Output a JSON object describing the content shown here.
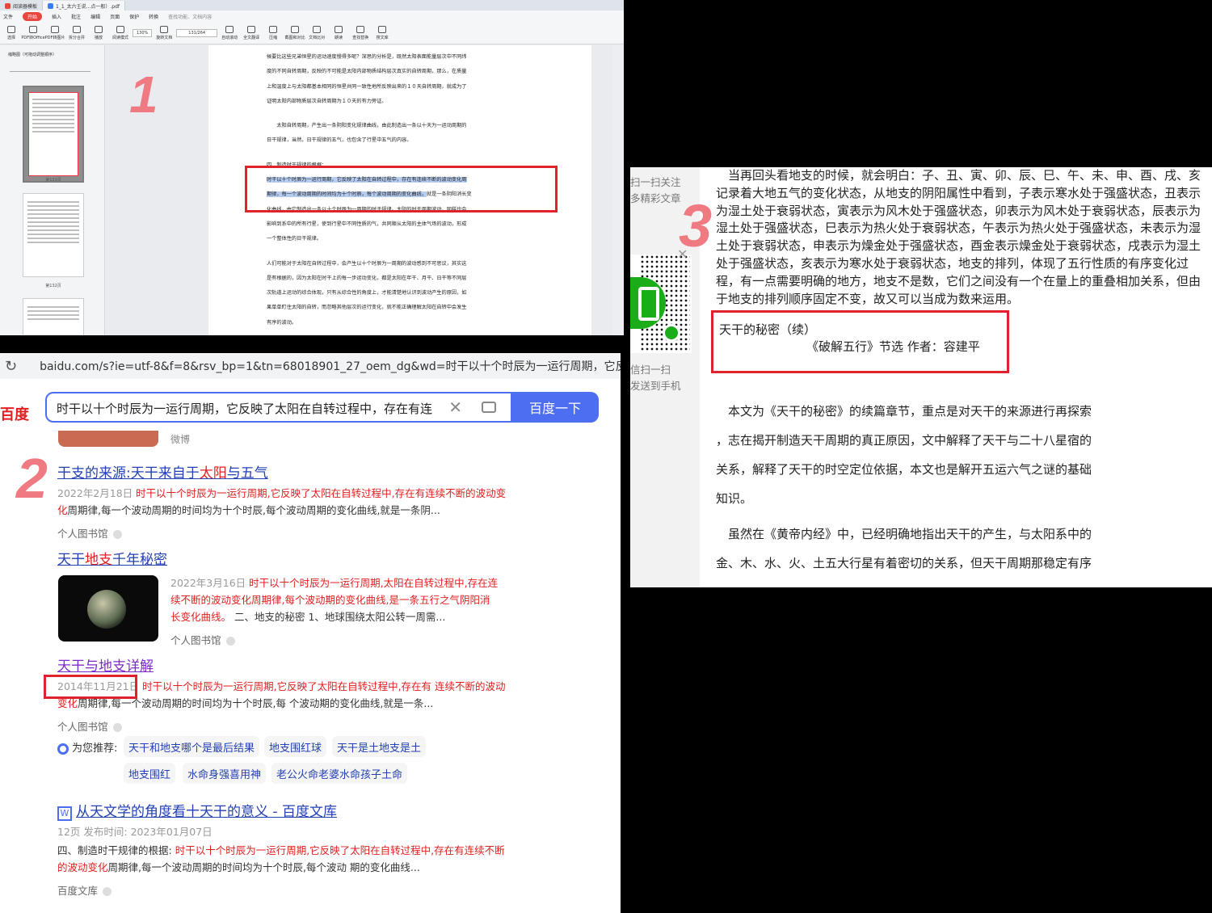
{
  "pdf": {
    "tabs": [
      "阅读器模板",
      "1_1_太六壬说...点一般）.pdf"
    ],
    "menu": [
      "文件",
      "开始",
      "插入",
      "批注",
      "编辑",
      "页面",
      "保护",
      "转换",
      "查找功能、文档内容"
    ],
    "tools": [
      "选择",
      "PDF转Office",
      "PDF转图片",
      "拆分合并",
      "播放",
      "阅读模式",
      "旋转文档",
      "单页",
      "双页",
      "连续阅读",
      "自动滚动",
      "全文翻译",
      "压缩",
      "截图和对比",
      "文档比对",
      "朗读",
      "查找替换",
      "搜文库"
    ],
    "zoom": "130%",
    "page": "131/264",
    "sidebar_title": "缩略图（可拖动调整顺序）",
    "thumb_labels": [
      "第131页",
      "第132页"
    ],
    "doc_lines": [
      "候要比这些兄弟恒星的运动速度慢得多呢？深思的分析是，既然太阳表面能量层次中不同纬",
      "度的不同自转周期，反映的不可能是太阳内部物质结构层次真实的自转周期，那么，在质量",
      "上和温度上与太阳都基本相同的恒星共同一致性地所反映出来的１０天自转周期，就成为了",
      "证明太阳内部物质层次自转周期为１０天的有力旁证。"
    ],
    "doc_para2": [
      "　　太阳自转周期，产生出一条阴阳变化规律曲线，由此制造出一条以十天为一运动周期的",
      "日干规律，当然，日干规律的五气，也包含了行星中五气的内容。"
    ],
    "doc_heading": "四、制造时干规律的根据：",
    "doc_hl1": "时干以十个时辰为一运行周期，它反映了太阳在自转过程中，存在有连续不断的波动变化周",
    "doc_hl2": "期律，每一个波动周期的时间均为十个时辰，每个波动周期的变化曲线，",
    "doc_hl2_rest": "就是一条阴阳消长变",
    "doc_lines3": [
      "化曲线，由它制造出一条以十个时辰为一周期的时干规律。太阳的时干周期波动，同样也会",
      "影响到系中的所有行星，使到行星中不同性质的气，共同顺从太阳的主体气场的波动，形成",
      "一个整体性的日干规律。"
    ],
    "doc_lines4": [
      "人们可能对于太阳在自转过程中，会产生以十个时辰为一周期的波动感到不可思议，其实这",
      "是有根据的，因为太阳在时干上的每一步运动变化，都是太阳在年干、月干、日干等不同层",
      "次轨道上运动的综合体现，只有从综合性的角度上，才能清楚地认识到波动产生的原因，如",
      "果单单盯住太阳的自转，而忽略其他层次的运行变化，就不能正确理解太阳在自转中会发生",
      "有序的波动。"
    ]
  },
  "baidu": {
    "url": "baidu.com/s?ie=utf-8&f=8&rsv_bp=1&tn=68018901_27_oem_dg&wd=时干以十个时辰为一运行周期，它反映",
    "logo": "百度",
    "query": "时干以十个时辰为一运行周期，它反映了太阳在自转过程中，存在有连",
    "search_btn": "百度一下",
    "top_source": "微博",
    "results": [
      {
        "title_a": "干支的来源:天干来自于",
        "title_em": "太阳",
        "title_b": "与五气",
        "date": "2022年2月18日",
        "snip_em": "时干以十个时辰为一运行周期,它反映了太阳在自转过程中,存在有连续不断的波动变化",
        "snip": "周期律,每一个波动周期的时间均为十个时辰,每个波动周期的变化曲线,就是一条阴...",
        "source": "个人图书馆"
      },
      {
        "title_a": "天干",
        "title_em": "地支",
        "title_b": "千年秘密",
        "date": "2022年3月16日",
        "snip_em": "时干以十个时辰为一运行周期,太阳在自转过程中,存在连续不断的波动变化周期律,每个波动期的变化曲线,是一条五行之气阴阳消长变化曲线。",
        "snip": " 二、地支的秘密 1、地球围绕太阳公转一周需...",
        "source": "个人图书馆"
      },
      {
        "title_a": "天干与地支详解",
        "title_em": "",
        "title_b": "",
        "date": "2014年11月21日",
        "snip_em": "时干以十个时辰为一运行周期,它反映了太阳在自转过程中,存在有 连续不断的波动变化",
        "snip": "周期律,每一个波动周期的时间均为十个时辰,每 个波动期的变化曲线,就是一条...",
        "source": "个人图书馆"
      },
      {
        "title_a": "从天文学的角度看十天干的意义 - 百度文库",
        "title_em": "",
        "title_b": "",
        "date": "12页 发布时间: 2023年01月07日",
        "snip_pre": "四、制造时干规律的根据: ",
        "snip_em": "时干以十个时辰为一运行周期,它反映了太阳在自转过程中,存在有连续不断的波动变化",
        "snip": "周期律,每一个波动周期的时间均为十个时辰,每个波动 期的变化曲线...",
        "source": "百度文库"
      }
    ],
    "recommend_label": "为您推荐:",
    "recommend": [
      "天干和地支哪个是最后结果",
      "地支围红球",
      "天干是土地支是土",
      "地支围红",
      "水命身强喜用神",
      "老公火命老婆水命孩子土命"
    ],
    "wenku_icon": "W"
  },
  "article": {
    "side_top": [
      "扫一扫关注",
      "多精彩文章"
    ],
    "side_bottom": [
      "信扫一扫",
      "发送到手机"
    ],
    "para1": "当再回头看地支的时候，就会明白：子、丑、寅、卯、辰、巳、午、未、申、酉、戌、亥记录着大地五气的变化状态，从地支的阴阳属性中看到，子表示寒水处于强盛状态，丑表示为湿土处于衰弱状态，寅表示为风木处于强盛状态，卯表示为风木处于衰弱状态，辰表示为湿土处于强盛状态，巳表示为热火处于衰弱状态，午表示为热火处于强盛状态，未表示为湿土处于衰弱状态，申表示为燥金处于强盛状态，酉金表示燥金处于衰弱状态，戌表示为湿土处于强盛状态，亥表示为寒水处于衰弱状态，地支的排列，体现了五行性质的有序变化过程，有一点需要明确的地方，地支不是数，它们之间没有一个在量上的重叠相加关系，但由于地支的排列顺序固定不变，故又可以当成为数来运用。",
    "title": "天干的秘密（续）",
    "subtitle": "《破解五行》节选 作者：容建平",
    "para2_lines": [
      "　本文为《天干的秘密》的续篇章节，重点是对天干的来源进行再探索",
      "，志在揭开制造天干周期的真正原因，文中解释了天干与二十八星宿的",
      "关系，解释了天干的时空定位依据，本文也是解开五运六气之谜的基础",
      "知识。"
    ],
    "para3_lines": [
      "　虽然在《黄帝内经》中，已经明确地指出天干的产生，与太阳系中的",
      "金、木、水、火、土五大行星有着密切的关系，但天干周期那稳定有序"
    ]
  },
  "marks": [
    "1",
    "2",
    "3"
  ],
  "colors": {
    "annotation_red": "#e0222e",
    "baidu_blue": "#4e6ef2",
    "highlight": "#b6cdf2"
  }
}
